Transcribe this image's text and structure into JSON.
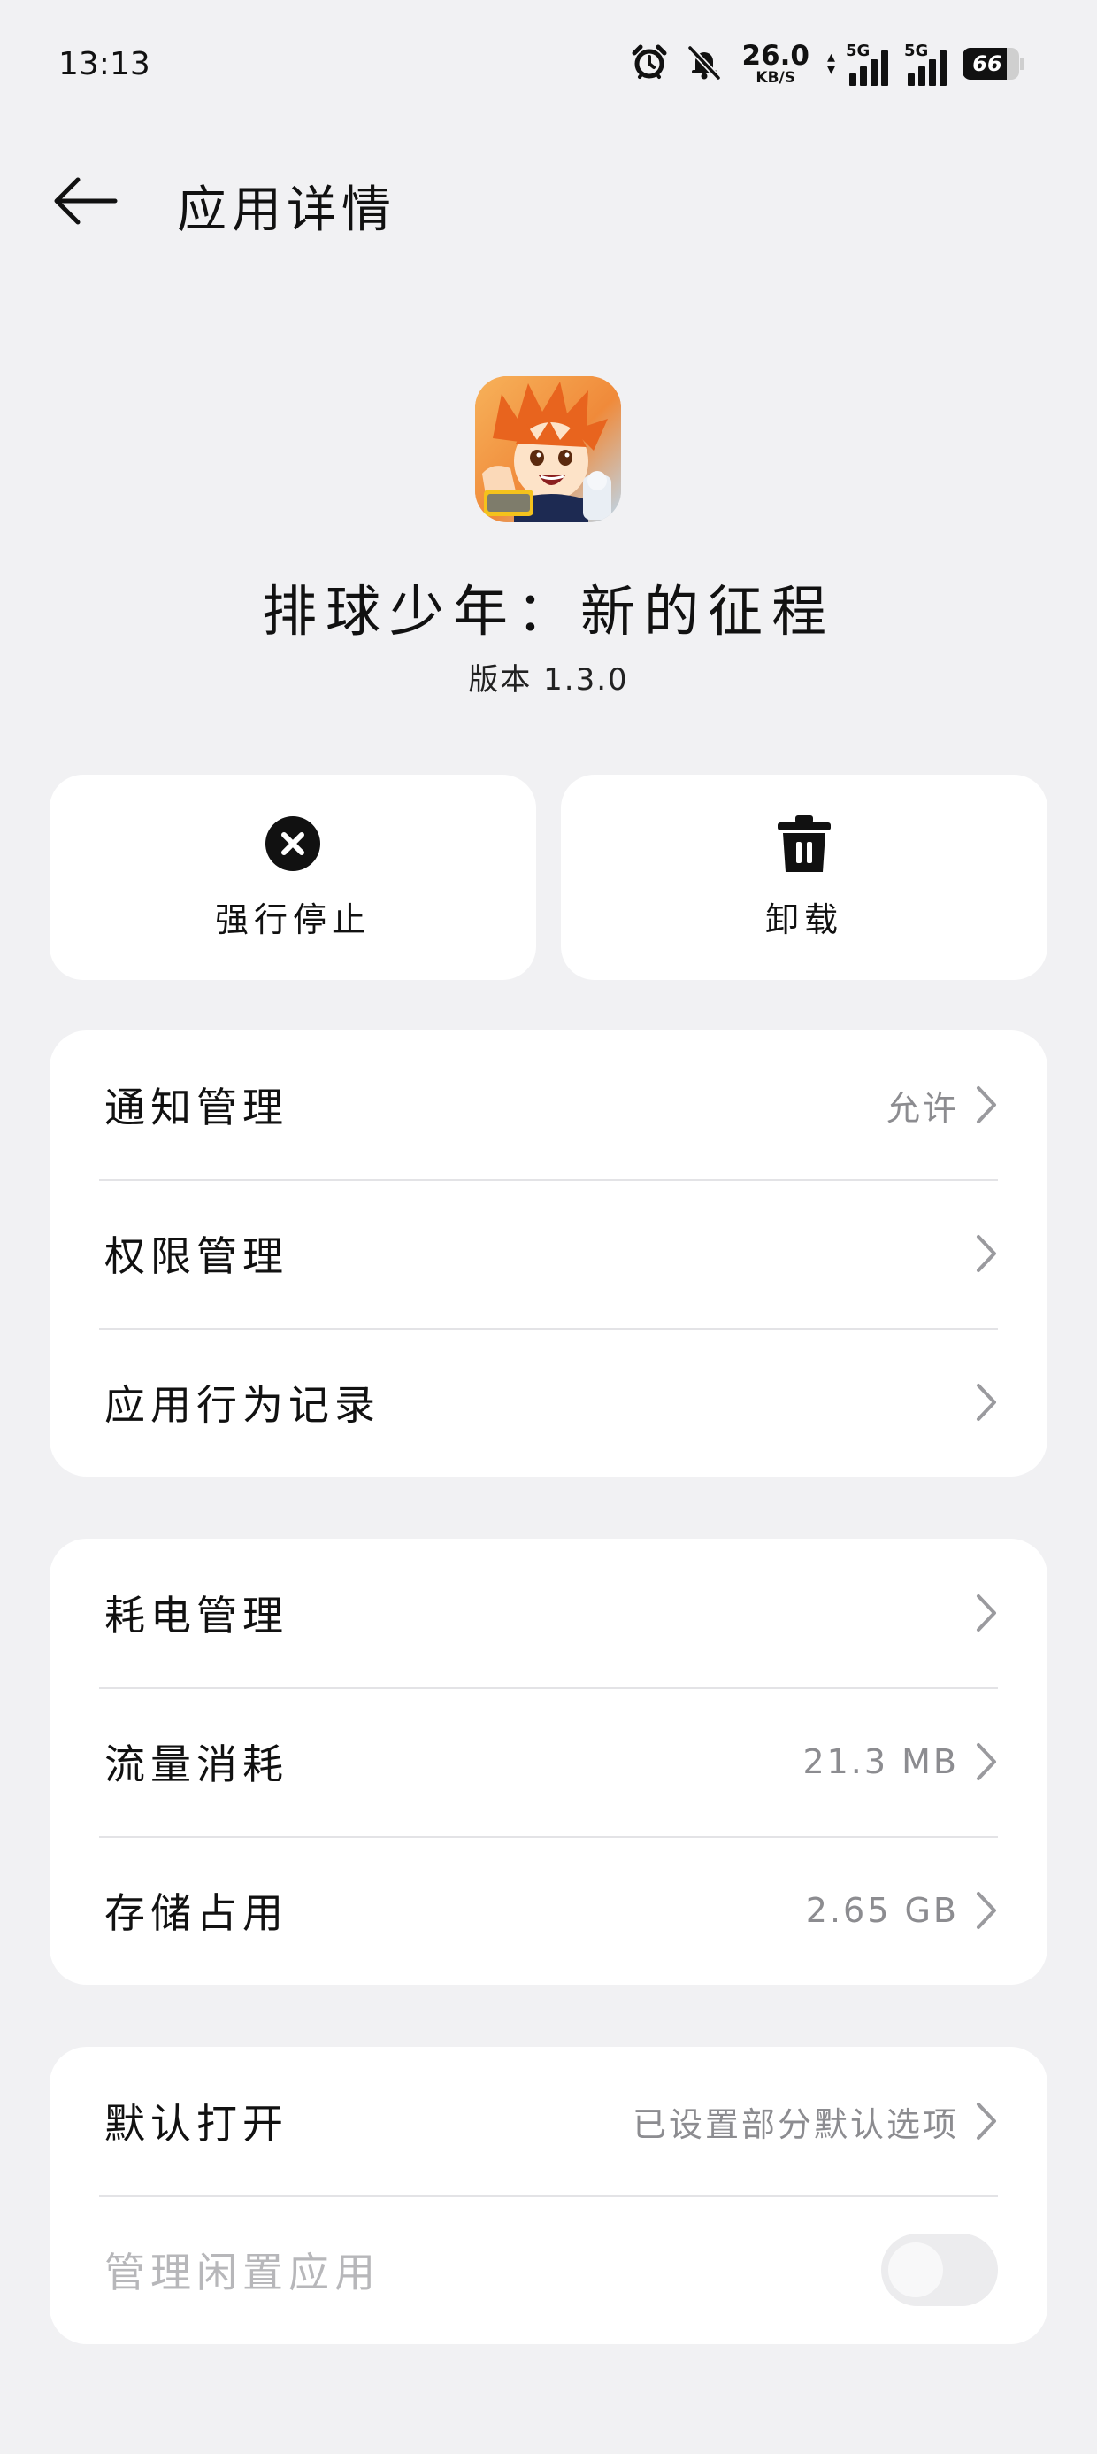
{
  "status_bar": {
    "time": "13:13",
    "net_speed_value": "26.0",
    "net_speed_unit": "KB/S",
    "sim1_tag": "5G",
    "sim2_tag": "5G",
    "battery_level": "66",
    "icons": [
      "alarm-icon",
      "mute-bell-icon",
      "data-arrows-icon",
      "signal-icon",
      "signal-icon",
      "battery-icon"
    ]
  },
  "header": {
    "title": "应用详情"
  },
  "app": {
    "name": "排球少年：新的征程",
    "version": "版本 1.3.0"
  },
  "actions": {
    "force_stop_label": "强行停止",
    "uninstall_label": "卸载"
  },
  "group1": {
    "notification": {
      "label": "通知管理",
      "value": "允许"
    },
    "permissions": {
      "label": "权限管理"
    },
    "behavior_log": {
      "label": "应用行为记录"
    }
  },
  "group2": {
    "battery": {
      "label": "耗电管理"
    },
    "data_usage": {
      "label": "流量消耗",
      "value": "21.3 MB"
    },
    "storage": {
      "label": "存储占用",
      "value": "2.65 GB"
    }
  },
  "group3": {
    "default_open": {
      "label": "默认打开",
      "value": "已设置部分默认选项"
    },
    "idle_manage": {
      "label": "管理闲置应用",
      "enabled": false
    }
  },
  "colors": {
    "background": "#f1f1f3",
    "card": "#ffffff",
    "secondary_text": "#8c8c90",
    "disabled_text": "#b7b7ba"
  }
}
